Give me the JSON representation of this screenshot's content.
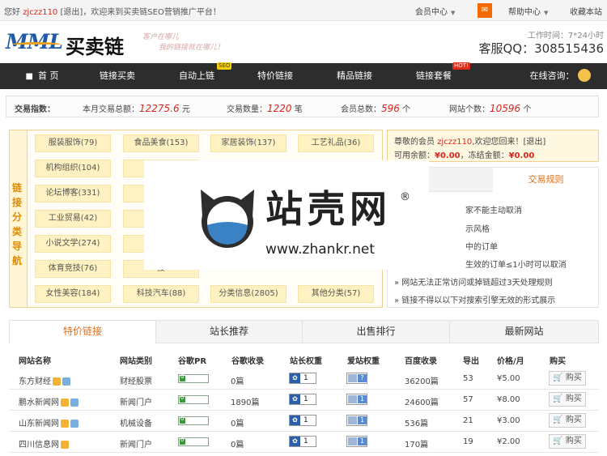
{
  "topbar": {
    "welcome_prefix": "您好 ",
    "username": "zjczz110",
    "logout": "[退出]",
    "welcome_suffix": "，欢迎来到买卖链SEO营销推广平台！",
    "member_center": "会员中心",
    "help_center": "帮助中心",
    "favorite": "收藏本站"
  },
  "header": {
    "logo_latin": "MML",
    "logo_cn": "买卖链",
    "slogan_line1": "客户在哪儿",
    "slogan_line2": "我的链接就在哪儿！",
    "work_time": "工作时间：7*24小时",
    "qq": "客服QQ：308515436"
  },
  "nav": {
    "items": [
      "首 页",
      "链接买卖",
      "自动上链",
      "特价链接",
      "精品链接",
      "链接套餐",
      "在线咨询："
    ],
    "badge_auto": "SEO",
    "badge_package": "HOT!"
  },
  "stats": {
    "label": "交易指数：",
    "monthly_label": "本月交易总额：",
    "monthly_value": "12275.6",
    "monthly_unit": "元",
    "count_label": "交易数量：",
    "count_value": "1220",
    "count_unit": "笔",
    "members_label": "会员总数：",
    "members_value": "596",
    "members_unit": "个",
    "sites_label": "网站个数：",
    "sites_value": "10596",
    "sites_unit": "个"
  },
  "categories": {
    "title_chars": [
      "链",
      "接",
      "分",
      "类",
      "导",
      "航"
    ],
    "items": [
      "服装服饰(79)",
      "食品美食(153)",
      "家居装饰(137)",
      "工艺礼品(36)",
      "机构组织(104)",
      "教",
      "",
      "",
      "论坛博客(331)",
      "电",
      "",
      "",
      "工业贸易(42)",
      "游",
      "",
      "",
      "小说文学(274)",
      "财",
      "",
      "",
      "体育竞技(76)",
      "搜",
      "",
      "",
      "女性美容(184)",
      "科技汽车(88)",
      "分类信息(2805)",
      "其他分类(57)"
    ]
  },
  "member": {
    "greeting_prefix": "尊敬的会员 ",
    "username": "zjczz110",
    "greeting_suffix": ",欢迎您回来！[退出]",
    "balance_label": "可用余额：",
    "balance_value": "¥0.00",
    "frozen_label": "，冻结金额：",
    "frozen_value": "¥0.00"
  },
  "rules": {
    "tab_label": "交易规则",
    "items": [
      "家不能主动取消",
      "示风格",
      "中的订单",
      "生效的订单≤1小时可以取消",
      "» 网站无法正常访问或掉链超过3天处理规则",
      "» 链接不得以以下对搜索引擎无效的形式展示"
    ]
  },
  "watermark": {
    "text": "站壳网",
    "reg": "®",
    "url": "www.zhankr.net"
  },
  "tabs": [
    "特价链接",
    "站长推荐",
    "出售排行",
    "最新网站"
  ],
  "table": {
    "headers": [
      "网站名称",
      "网站类别",
      "谷歌PR",
      "谷歌收录",
      "站长权重",
      "爱站权重",
      "百度收录",
      "导出",
      "价格/月",
      "购买"
    ],
    "rows": [
      {
        "name": "东方财经",
        "category": "财经股票",
        "pr": "0",
        "google": "0篇",
        "zz": "1",
        "az": "?",
        "baidu": "36200篇",
        "out": "53",
        "price": "¥5.00",
        "buy": "购买"
      },
      {
        "name": "鹏水新闻网",
        "category": "新闻门户",
        "pr": "0",
        "google": "1890篇",
        "zz": "1",
        "az": "1",
        "baidu": "24600篇",
        "out": "57",
        "price": "¥8.00",
        "buy": "购买"
      },
      {
        "name": "山东新闻网",
        "category": "机械设备",
        "pr": "0",
        "google": "0篇",
        "zz": "1",
        "az": "1",
        "baidu": "536篇",
        "out": "21",
        "price": "¥3.00",
        "buy": "购买"
      },
      {
        "name": "四川信息网",
        "category": "新闻门户",
        "pr": "0",
        "google": "0篇",
        "zz": "1",
        "az": "1",
        "baidu": "170篇",
        "out": "19",
        "price": "¥2.00",
        "buy": "购买"
      }
    ]
  }
}
